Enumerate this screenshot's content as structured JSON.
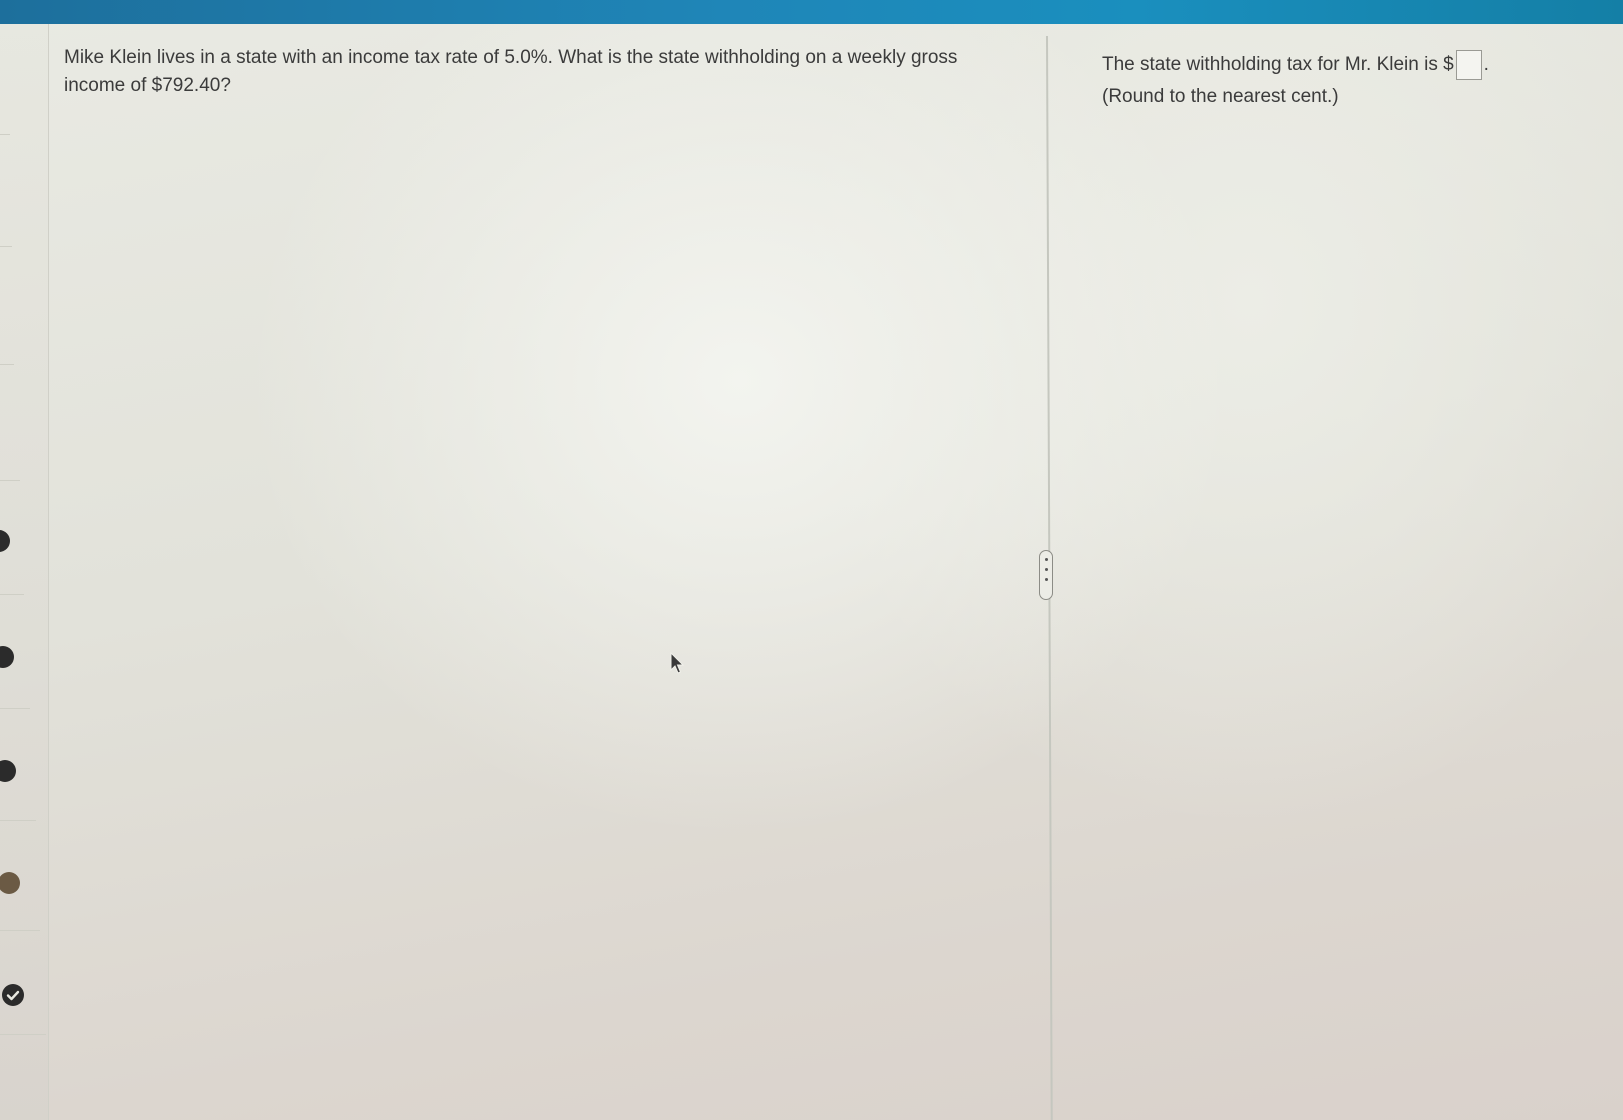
{
  "question": {
    "text": "Mike Klein lives in a state with an income tax rate of 5.0%. What is the state withholding on a weekly gross income of $792.40?"
  },
  "answer": {
    "prefix": "The state withholding tax for Mr. Klein is $",
    "value": "",
    "suffix": ".",
    "hint": "(Round to the nearest cent.)"
  },
  "colors": {
    "top_bar": "#1f86b8",
    "status_dot": "#2b2b2b"
  },
  "icons": {
    "divider_handle": "vertical-ellipsis-icon",
    "cursor": "mouse-pointer-icon",
    "status": "checkmark-circle-icon"
  }
}
